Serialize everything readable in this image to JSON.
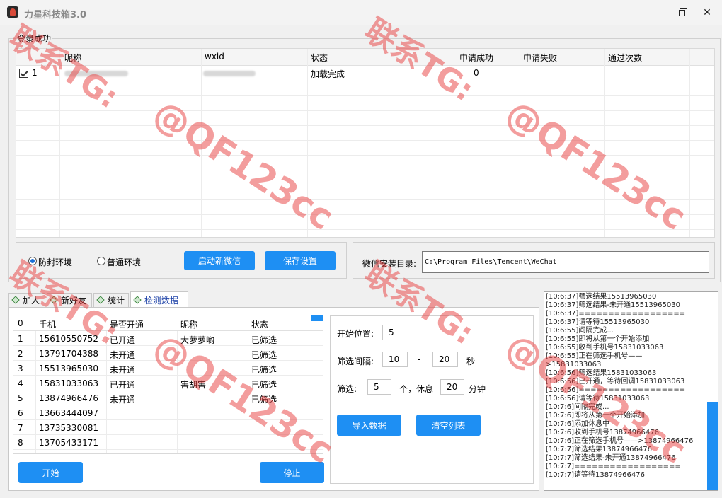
{
  "window": {
    "title": "力星科技箱3.0"
  },
  "login": {
    "status_caption": "登录成功",
    "columns": [
      "昵称",
      "wxid",
      "状态",
      "申请成功",
      "申请失败",
      "通过次数"
    ],
    "rows": [
      {
        "index": "1",
        "status": "加载完成",
        "apply_success": "0"
      }
    ]
  },
  "env": {
    "option_anti_ban": "防封环境",
    "option_normal": "普通环境",
    "selected": "防封环境",
    "start_wechat_label": "启动新微信",
    "save_settings_label": "保存设置"
  },
  "path": {
    "label": "微信安装目录:",
    "value": "C:\\Program Files\\Tencent\\WeChat"
  },
  "tabs": [
    {
      "label": "加人"
    },
    {
      "label": "新好友"
    },
    {
      "label": "统计"
    },
    {
      "label": "检测数据",
      "active": true
    }
  ],
  "data_table": {
    "columns": [
      "0",
      "手机",
      "是否开通",
      "昵称",
      "状态"
    ],
    "rows": [
      {
        "no": "1",
        "phone": "15610550752",
        "opened": "已开通",
        "nickname": "大萝萝哟",
        "status": "已筛选"
      },
      {
        "no": "2",
        "phone": "13791704388",
        "opened": "未开通",
        "nickname": "",
        "status": "已筛选"
      },
      {
        "no": "3",
        "phone": "15513965030",
        "opened": "未开通",
        "nickname": "",
        "status": "已筛选"
      },
      {
        "no": "4",
        "phone": "15831033063",
        "opened": "已开通",
        "nickname": "害胡害",
        "status": "已筛选"
      },
      {
        "no": "5",
        "phone": "13874966476",
        "opened": "未开通",
        "nickname": "",
        "status": "已筛选"
      },
      {
        "no": "6",
        "phone": "13663444097",
        "opened": "",
        "nickname": "",
        "status": ""
      },
      {
        "no": "7",
        "phone": "13735330081",
        "opened": "",
        "nickname": "",
        "status": ""
      },
      {
        "no": "8",
        "phone": "13705433171",
        "opened": "",
        "nickname": "",
        "status": ""
      }
    ]
  },
  "settings": {
    "start_pos_label": "开始位置:",
    "start_pos_value": "5",
    "interval_label": "筛选间隔:",
    "interval_min": "10",
    "interval_sep": "-",
    "interval_max": "20",
    "interval_unit": "秒",
    "filter_label": "筛选:",
    "filter_count": "5",
    "filter_rest_label": "个，休息",
    "filter_rest_value": "20",
    "filter_rest_unit": "分钟",
    "import_label": "导入数据",
    "clear_label": "清空列表"
  },
  "actions": {
    "start_label": "开始",
    "stop_label": "停止"
  },
  "log": [
    "[10:6:37]筛选结果15513965030",
    "[10:6:37]筛选结果-未开通15513965030",
    "[10:6:37]==================",
    "[10:6:37]请等待15513965030",
    "[10:6:55]间隔完成...",
    "[10:6:55]即将从第一个开始添加",
    "[10:6:55]收到手机号15831033063",
    "[10:6:55]正在筛选手机号——",
    ">15831033063",
    "[10:6:56]筛选结果15831033063",
    "[10:6:56]已开通，等待回调15831033063",
    "[10:6:56]==================",
    "[10:6:56]请等待15831033063",
    "[10:7:6]间隔完成...",
    "[10:7:6]即将从第一个开始添加",
    "[10:7:6]添加休息中",
    "[10:7:6]收到手机号13874966476",
    "[10:7:6]正在筛选手机号——>13874966476",
    "[10:7:7]筛选结果13874966476",
    "[10:7:7]筛选结果-未开通13874966476",
    "[10:7:7]==================",
    "[10:7:7]请等待13874966476"
  ],
  "watermark": {
    "contact": "联系TG:",
    "handle": "@QF123cc"
  }
}
